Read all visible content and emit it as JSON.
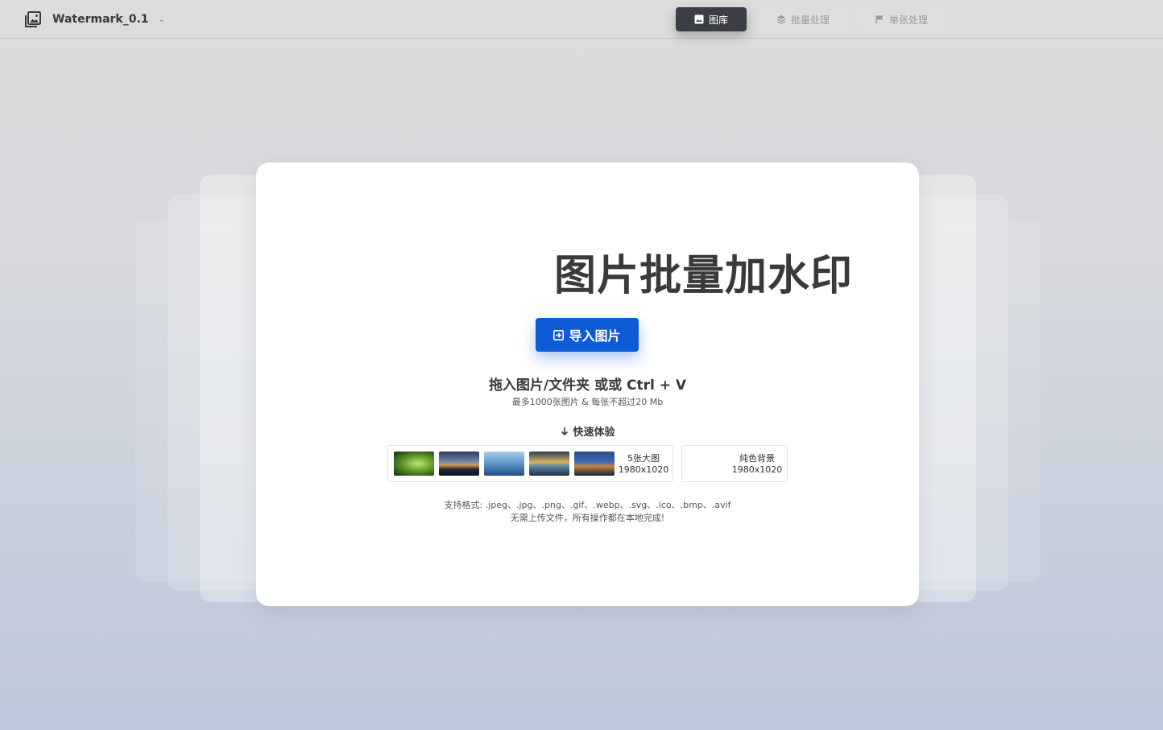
{
  "app": {
    "title": "Watermark_0.1",
    "icon": "gallery-icon",
    "caret_icon": "chevron-down-icon"
  },
  "tabs": [
    {
      "label": "图库",
      "icon": "image-icon",
      "active": true
    },
    {
      "label": "批量处理",
      "icon": "layers-icon",
      "active": false
    },
    {
      "label": "单张处理",
      "icon": "flag-icon",
      "active": false
    }
  ],
  "main": {
    "title": "图片批量加水印",
    "import_button": {
      "label": "导入图片",
      "icon": "import-icon"
    },
    "drop_hint": "拖入图片/文件夹 或或 Ctrl + V",
    "limits": "最多1000张图片 & 每张不超过20 Mb",
    "quick_try": {
      "label": "快速体验",
      "icon": "arrow-down-icon"
    },
    "samples": {
      "name": "5张大图",
      "size": "1980x1020",
      "thumb_count": 5
    },
    "solid": {
      "name": "纯色背景",
      "size": "1980x1020"
    },
    "formats": "支持格式: .jpeg、.jpg、.png、.gif、.webp、.svg、.ico、.bmp、.avif",
    "privacy": "无需上传文件，所有操作都在本地完成!"
  },
  "colors": {
    "accent": "#0d5bd7",
    "active_tab": "#3b3f45",
    "text": "#3a3a3a"
  }
}
